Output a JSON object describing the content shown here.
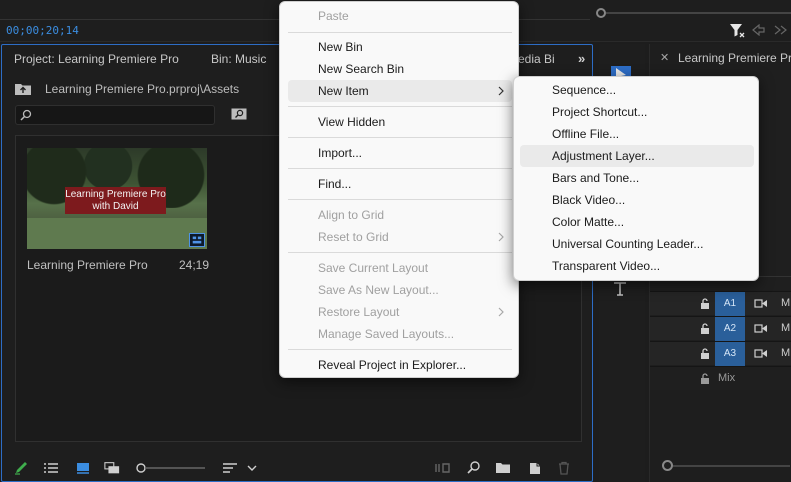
{
  "source_monitor": {
    "timecode": "00;00;20;14"
  },
  "project_panel": {
    "tabs": [
      "Project: Learning Premiere Pro",
      "Bin: Music",
      "edia Bi"
    ],
    "path": "Learning Premiere Pro.prproj\\Assets",
    "search": {
      "value": "",
      "placeholder": ""
    },
    "clip": {
      "title_line1": "Learning Premiere Pro",
      "title_line2": "with David",
      "name": "Learning Premiere Pro",
      "duration": "24;19"
    }
  },
  "timeline": {
    "tab_label": "Learning Premiere Pro - Mo",
    "audio_tracks": [
      "A1",
      "A2",
      "A3"
    ],
    "mute_label": "M",
    "mix_label": "Mix"
  },
  "context_menu": {
    "items": [
      {
        "label": "Paste",
        "enabled": false
      },
      {
        "label": "New Bin",
        "enabled": true
      },
      {
        "label": "New Search Bin",
        "enabled": true
      },
      {
        "label": "New Item",
        "enabled": true,
        "submenu": true,
        "hovered": true
      },
      {
        "label": "View Hidden",
        "enabled": true
      },
      {
        "label": "Import...",
        "enabled": true
      },
      {
        "label": "Find...",
        "enabled": true
      },
      {
        "label": "Align to Grid",
        "enabled": false
      },
      {
        "label": "Reset to Grid",
        "enabled": false,
        "submenu": true
      },
      {
        "label": "Save Current Layout",
        "enabled": false
      },
      {
        "label": "Save As New Layout...",
        "enabled": false
      },
      {
        "label": "Restore Layout",
        "enabled": false,
        "submenu": true
      },
      {
        "label": "Manage Saved Layouts...",
        "enabled": false
      },
      {
        "label": "Reveal Project in Explorer...",
        "enabled": true
      }
    ]
  },
  "new_item_submenu": {
    "items": [
      "Sequence...",
      "Project Shortcut...",
      "Offline File...",
      "Adjustment Layer...",
      "Bars and Tone...",
      "Black Video...",
      "Color Matte...",
      "Universal Counting Leader...",
      "Transparent Video..."
    ],
    "hovered_index": 3
  },
  "colors": {
    "accent_blue": "#2d6dc6",
    "timecode_blue": "#3b8de0",
    "track_target": "#2a5f9a",
    "title_card_red": "#7d1a1d"
  }
}
